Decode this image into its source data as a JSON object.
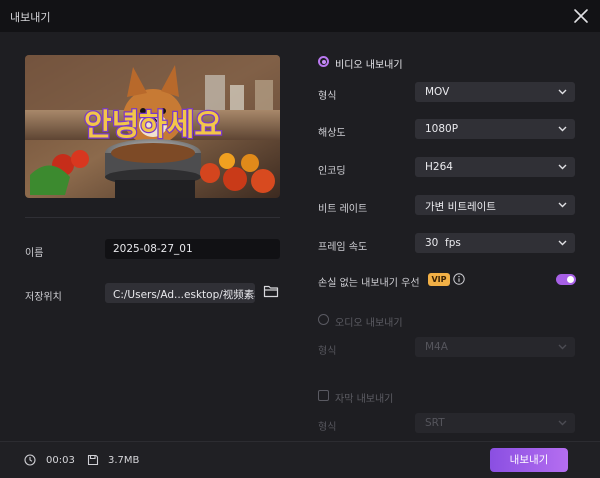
{
  "window": {
    "title": "내보내기"
  },
  "preview": {
    "caption": "안녕하세요"
  },
  "file": {
    "name_label": "이름",
    "name_value": "2025-08-27_01",
    "location_label": "저장위치",
    "location_value": "C:/Users/Ad...esktop/视频素材"
  },
  "video": {
    "title": "비디오 내보내기",
    "rows": [
      {
        "label": "형식",
        "value": "MOV"
      },
      {
        "label": "해상도",
        "value": "1080P"
      },
      {
        "label": "인코딩",
        "value": "H264"
      },
      {
        "label": "비트 레이트",
        "value": "가변 비트레이트"
      },
      {
        "label": "프레임 속도",
        "value": "30  fps"
      }
    ],
    "lossless_label": "손실 없는 내보내기 우선",
    "vip_badge": "VIP"
  },
  "audio": {
    "title": "오디오 내보내기",
    "format_label": "형식",
    "format_value": "M4A"
  },
  "subtitle": {
    "title": "자막 내보내기",
    "format_label": "형식",
    "format_value": "SRT"
  },
  "footer": {
    "duration": "00:03",
    "size": "3.7MB",
    "export_button": "내보내기"
  },
  "colors": {
    "accent": "#b56ef0",
    "vip": "#f2b046",
    "background": "#1e1e22"
  }
}
